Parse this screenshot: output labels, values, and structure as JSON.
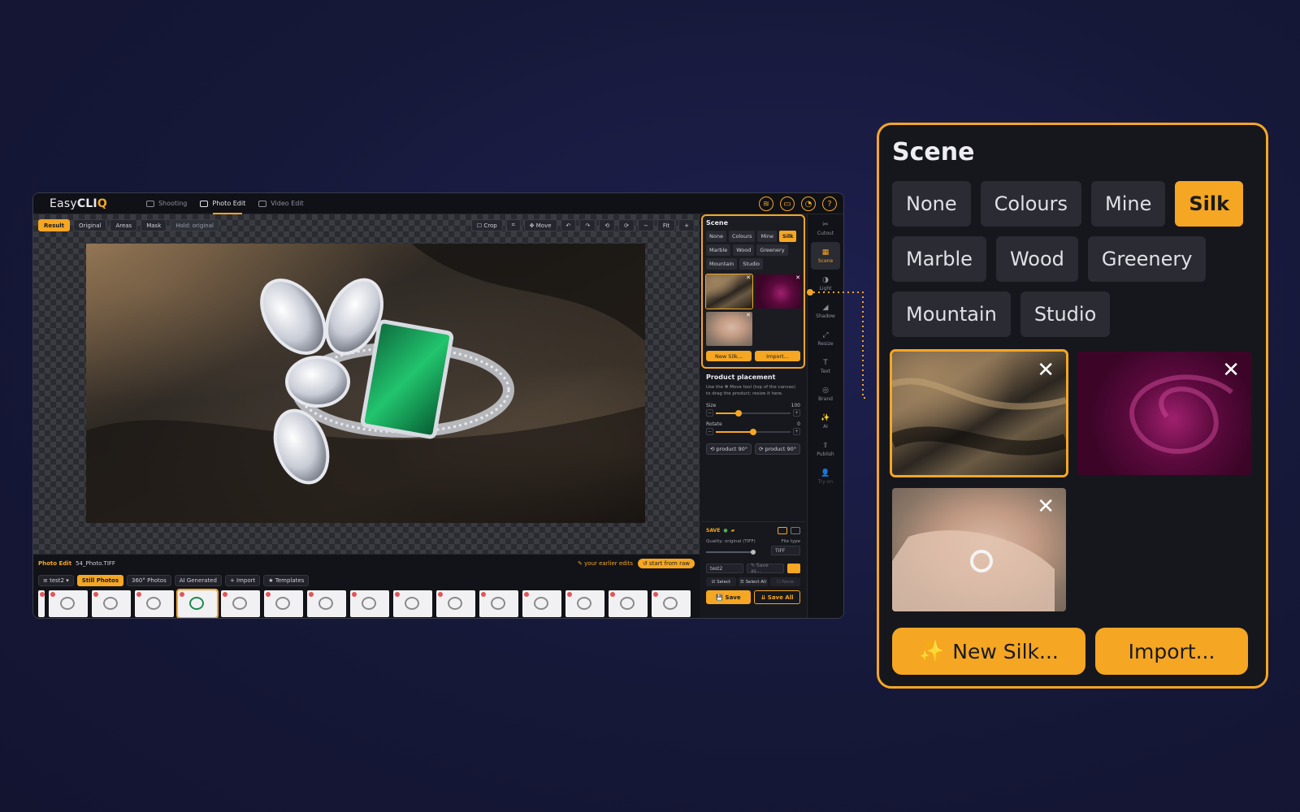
{
  "app": {
    "logo_prefix": "Easy",
    "logo_bold": "CLI",
    "logo_q": "Q",
    "modes": [
      "Shooting",
      "Photo Edit",
      "Video Edit"
    ],
    "active_mode": "Photo Edit"
  },
  "canvas_toolbar_left": {
    "result": "Result",
    "original": "Original",
    "areas": "Areas",
    "mask": "Mask",
    "hold": "Hold: original"
  },
  "canvas_toolbar_right": {
    "crop": "☐ Crop",
    "move": "✥ Move",
    "fit": "Fit",
    "minus": "−",
    "plus": "+"
  },
  "scene": {
    "title": "Scene",
    "chips": [
      "None",
      "Colours",
      "Mine",
      "Silk",
      "Marble",
      "Wood",
      "Greenery",
      "Mountain",
      "Studio"
    ],
    "active_chip": "Silk",
    "new_button": "New Silk...",
    "import_button": "Import..."
  },
  "placement": {
    "title": "Product placement",
    "description": "Use the ✥ Move tool (top of the canvas) to drag the product; resize it here.",
    "size_label": "Size",
    "size_value": "100",
    "rotate_label": "Rotate",
    "rotate_value": "0",
    "rotate_left": "⟲ product 90°",
    "rotate_right": "⟳ product 90°"
  },
  "save": {
    "heading": "SAVE",
    "quality_label": "Quality: original (TIFF)",
    "file_type_label": "File type",
    "file_type_value": "TIFF",
    "name_value": "test2",
    "save_as_placeholder": "✎ Save as...",
    "select": "☑ Select",
    "select_all": "☰ Select All",
    "none": "☐ None",
    "save_button": "💾 Save",
    "save_all_button": "⇊ Save All"
  },
  "rail": [
    "Cutout",
    "Scene",
    "Light",
    "Shadow",
    "Resize",
    "Text",
    "Brand",
    "AI",
    "Publish",
    "Try-on"
  ],
  "rail_glyphs": [
    "✂",
    "▦",
    "◑",
    "◢",
    "⤢",
    "T",
    "◎",
    "✨",
    "⇪",
    "👤"
  ],
  "filmstrip": {
    "section": "Photo Edit",
    "filename": "54_Photo.TIFF",
    "earlier_edits": "✎ your earlier edits",
    "start_from_raw": "↺ start from raw",
    "tabs": [
      "≡ test2 ▾",
      "Still Photos",
      "360° Photos",
      "AI Generated",
      "+ Import",
      "★ Templates"
    ],
    "active_tab": "Still Photos",
    "selected_thumb": 3
  },
  "colors": {
    "accent": "#f5a623",
    "panel_bg": "#16171c",
    "page_bg": "#161838"
  }
}
